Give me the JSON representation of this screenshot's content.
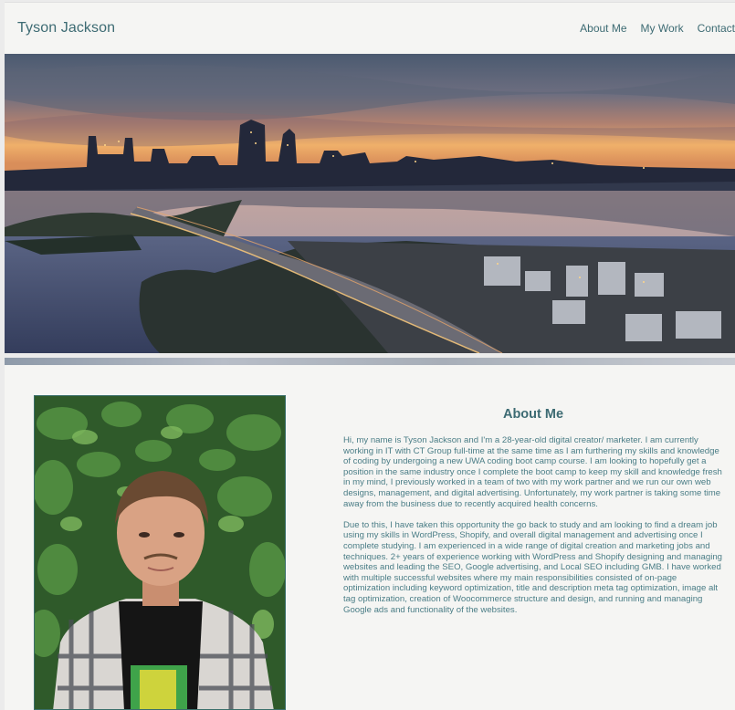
{
  "header": {
    "brand": "Tyson Jackson",
    "nav": [
      "About Me",
      "My Work",
      "Contact"
    ]
  },
  "about": {
    "title": "About Me",
    "paragraphs": [
      "Hi, my name is Tyson Jackson and I'm a 28-year-old digital creator/ marketer. I am currently working in IT with CT Group full-time at the same time as I am furthering my skills and knowledge of coding by undergoing a new UWA coding boot camp course. I am looking to hopefully get a position in the same industry once I complete the boot camp to keep my skill and knowledge fresh in my mind, I previously worked in a team of two with my work partner and we run our own web designs, management, and digital advertising. Unfortunately, my work partner is taking some time away from the business due to recently acquired health concerns.",
      "Due to this, I have taken this opportunity the go back to study and am looking to find a dream job using my skills in WordPress, Shopify, and overall digital management and advertising once I complete studying. I am experienced in a wide range of digital creation and marketing jobs and techniques. 2+ years of experience working with WordPress and Shopify designing and managing websites and leading the SEO, Google advertising, and Local SEO including GMB. I have worked with multiple successful websites where my main responsibilities consisted of on-page optimization including keyword optimization, title and description meta tag optimization, image alt tag optimization, creation of Woocommerce structure and design, and running and managing Google ads and functionality of the websites."
    ]
  },
  "colors": {
    "accent": "#3d6b73",
    "body_text": "#4a7d86",
    "background": "#f5f5f3"
  }
}
